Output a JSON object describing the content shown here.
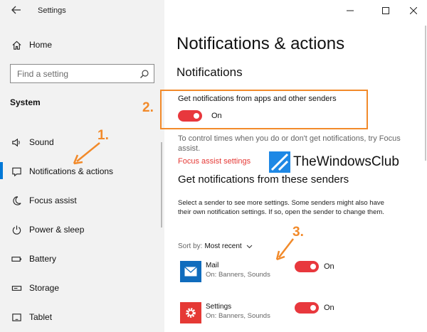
{
  "window": {
    "app_title": "Settings"
  },
  "sidebar": {
    "home_label": "Home",
    "search_placeholder": "Find a setting",
    "section_label": "System",
    "items": [
      {
        "label": "Sound",
        "icon": "speaker-icon"
      },
      {
        "label": "Notifications & actions",
        "icon": "notification-icon",
        "active": true
      },
      {
        "label": "Focus assist",
        "icon": "moon-icon"
      },
      {
        "label": "Power & sleep",
        "icon": "power-icon"
      },
      {
        "label": "Battery",
        "icon": "battery-icon"
      },
      {
        "label": "Storage",
        "icon": "storage-icon"
      },
      {
        "label": "Tablet",
        "icon": "tablet-icon"
      }
    ]
  },
  "main": {
    "page_title": "Notifications & actions",
    "subheading": "Notifications",
    "main_toggle": {
      "label": "Get notifications from apps and other senders",
      "state": "On"
    },
    "focus_info": "To control times when you do or don't get notifications, try Focus assist.",
    "focus_link": "Focus assist settings",
    "senders_heading": "Get notifications from these senders",
    "senders_description": "Select a sender to see more settings. Some senders might also have their own notification settings. If so, open the sender to change them.",
    "sort": {
      "label": "Sort by:",
      "value": "Most recent"
    },
    "senders": [
      {
        "name": "Mail",
        "detail": "On: Banners, Sounds",
        "state": "On",
        "icon": "mail-icon"
      },
      {
        "name": "Settings",
        "detail": "On: Banners, Sounds",
        "state": "On",
        "icon": "settings-gear-icon"
      }
    ]
  },
  "watermark": {
    "text": "TheWindowsClub"
  },
  "annotations": [
    "1.",
    "2.",
    "3."
  ],
  "colors": {
    "accent": "#0078d7",
    "toggle_on": "#e8383d",
    "annotation": "#f28a2a",
    "link": "#e53935"
  }
}
